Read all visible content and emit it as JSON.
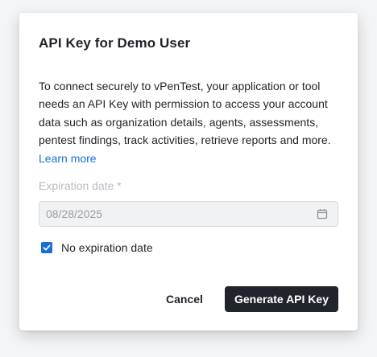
{
  "dialog": {
    "title": "API Key for Demo User",
    "description": "To connect securely to vPenTest, your application or tool needs an API Key with permission to access your account data such as organization details, agents, assessments, pentest findings, track activities, retrieve reports and more.",
    "learn_more": "Learn more",
    "expiration": {
      "label": "Expiration date *",
      "value": "08/28/2025",
      "icon": "calendar-icon",
      "disabled": true
    },
    "no_expiration": {
      "label": "No expiration date",
      "checked": true
    },
    "cancel_label": "Cancel",
    "generate_label": "Generate API Key"
  },
  "colors": {
    "accent": "#1a6fd6",
    "primary_button": "#21252b",
    "disabled_field": "#f1f2f3",
    "muted_text": "#b7bcc2"
  }
}
